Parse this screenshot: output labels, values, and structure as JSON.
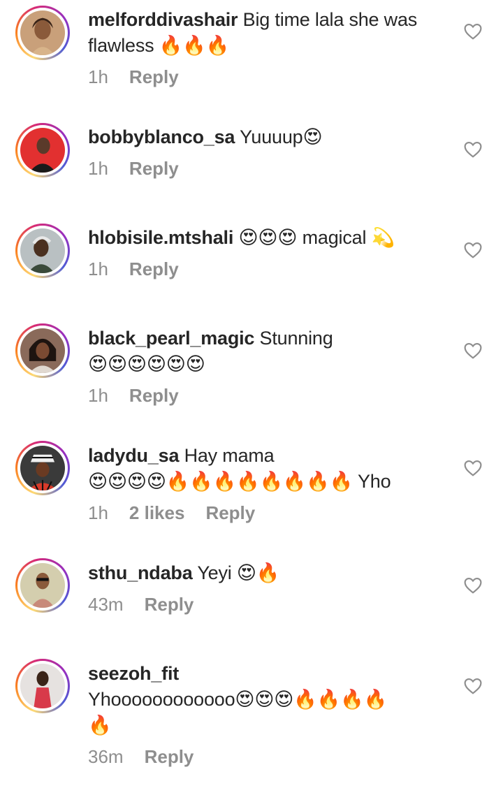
{
  "comments": [
    {
      "username": "melforddivashair",
      "text_line1": " Big time lala she was",
      "text_line2": "flawless 🔥🔥🔥",
      "time": "1h",
      "likes": "",
      "reply": "Reply",
      "avatar_bg": "#b88a5a"
    },
    {
      "username": "bobbyblanco_sa",
      "text_line1": " Yuuuup😍",
      "text_line2": "",
      "time": "1h",
      "likes": "",
      "reply": "Reply",
      "avatar_bg": "#d92a2a"
    },
    {
      "username": "hlobisile.mtshali",
      "text_line1": " 😍😍😍 magical 💫",
      "text_line2": "",
      "time": "1h",
      "likes": "",
      "reply": "Reply",
      "avatar_bg": "#9aa3a5"
    },
    {
      "username": "black_pearl_magic",
      "text_line1": " Stunning",
      "text_line2": "😍😍😍😍😍😍",
      "time": "1h",
      "likes": "",
      "reply": "Reply",
      "avatar_bg": "#6a4a3a"
    },
    {
      "username": "ladydu_sa",
      "text_line1": " Hay mama",
      "text_line2": "😍😍😍😍🔥🔥🔥🔥🔥🔥🔥🔥 Yho",
      "time": "1h",
      "likes": "2 likes",
      "reply": "Reply",
      "avatar_bg": "#2b2b2b"
    },
    {
      "username": "sthu_ndaba",
      "text_line1": " Yeyi 😍🔥",
      "text_line2": "",
      "time": "43m",
      "likes": "",
      "reply": "Reply",
      "avatar_bg": "#c9c39a"
    },
    {
      "username": "seezoh_fit",
      "text_line1": "",
      "text_line2": "Yhoooooooooooo😍😍😍🔥🔥🔥🔥",
      "text_line3": "🔥",
      "time": "36m",
      "likes": "",
      "reply": "Reply",
      "avatar_bg": "#d8d2d0"
    }
  ],
  "icons": {
    "like": "heart-outline-icon"
  },
  "colors": {
    "username": "#262626",
    "meta": "#8e8e8e",
    "heart_stroke": "#8e8e8e"
  }
}
